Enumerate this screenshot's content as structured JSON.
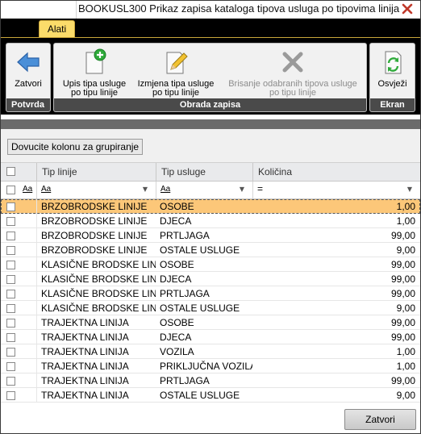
{
  "window": {
    "title": "BOOKUSL300  Prikaz zapisa kataloga tipova usluga po tipovima linija",
    "close_icon": "close-icon"
  },
  "ribbon": {
    "tab_label": "Alati",
    "groups": {
      "potvrda": "Potvrda",
      "obrada": "Obrada zapisa",
      "ekran": "Ekran"
    },
    "buttons": {
      "zatvori": {
        "label": "Zatvori",
        "icon": "back-arrow-icon"
      },
      "upis": {
        "label_line1": "Upis tipa usluge",
        "label_line2": "po tipu linije",
        "icon": "new-document-icon"
      },
      "izmjena": {
        "label_line1": "Izmjena tipa usluge",
        "label_line2": "po tipu linije",
        "icon": "edit-document-icon"
      },
      "brisanje": {
        "label_line1": "Brisanje odabranih tipova usluge",
        "label_line2": "po tipu linije",
        "icon": "delete-x-icon",
        "disabled": true
      },
      "osvjezi": {
        "label": "Osvježi",
        "icon": "refresh-icon"
      }
    }
  },
  "grid": {
    "group_hint": "Dovucite kolonu za grupiranje",
    "columns": [
      "Tip linije",
      "Tip usluge",
      "Količina"
    ],
    "filter_symbols": {
      "text": "Aa",
      "numeric": "="
    },
    "selected_row_index": 0,
    "rows": [
      {
        "tip_linije": "BRZOBRODSKE LINIJE",
        "tip_usluge": "OSOBE",
        "kolicina": "1,00"
      },
      {
        "tip_linije": "BRZOBRODSKE LINIJE",
        "tip_usluge": "DJECA",
        "kolicina": "1,00"
      },
      {
        "tip_linije": "BRZOBRODSKE LINIJE",
        "tip_usluge": "PRTLJAGA",
        "kolicina": "99,00"
      },
      {
        "tip_linije": "BRZOBRODSKE LINIJE",
        "tip_usluge": "OSTALE USLUGE",
        "kolicina": "9,00"
      },
      {
        "tip_linije": "KLASIČNE BRODSKE LINIJE",
        "tip_usluge": "OSOBE",
        "kolicina": "99,00"
      },
      {
        "tip_linije": "KLASIČNE BRODSKE LINIJE",
        "tip_usluge": "DJECA",
        "kolicina": "99,00"
      },
      {
        "tip_linije": "KLASIČNE BRODSKE LINIJE",
        "tip_usluge": "PRTLJAGA",
        "kolicina": "99,00"
      },
      {
        "tip_linije": "KLASIČNE BRODSKE LINIJE",
        "tip_usluge": "OSTALE USLUGE",
        "kolicina": "9,00"
      },
      {
        "tip_linije": "TRAJEKTNA LINIJA",
        "tip_usluge": "OSOBE",
        "kolicina": "99,00"
      },
      {
        "tip_linije": "TRAJEKTNA LINIJA",
        "tip_usluge": "DJECA",
        "kolicina": "99,00"
      },
      {
        "tip_linije": "TRAJEKTNA LINIJA",
        "tip_usluge": "VOZILA",
        "kolicina": "1,00"
      },
      {
        "tip_linije": "TRAJEKTNA LINIJA",
        "tip_usluge": "PRIKLJUČNA VOZILA",
        "kolicina": "1,00"
      },
      {
        "tip_linije": "TRAJEKTNA LINIJA",
        "tip_usluge": "PRTLJAGA",
        "kolicina": "99,00"
      },
      {
        "tip_linije": "TRAJEKTNA LINIJA",
        "tip_usluge": "OSTALE USLUGE",
        "kolicina": "9,00"
      }
    ]
  },
  "footer": {
    "close_label": "Zatvori"
  },
  "colors": {
    "tab_accent": "#fbdc6a",
    "selected_row": "#fcc779",
    "ribbon_background": "#000000",
    "group_label_bar": "#4a4a4a"
  }
}
